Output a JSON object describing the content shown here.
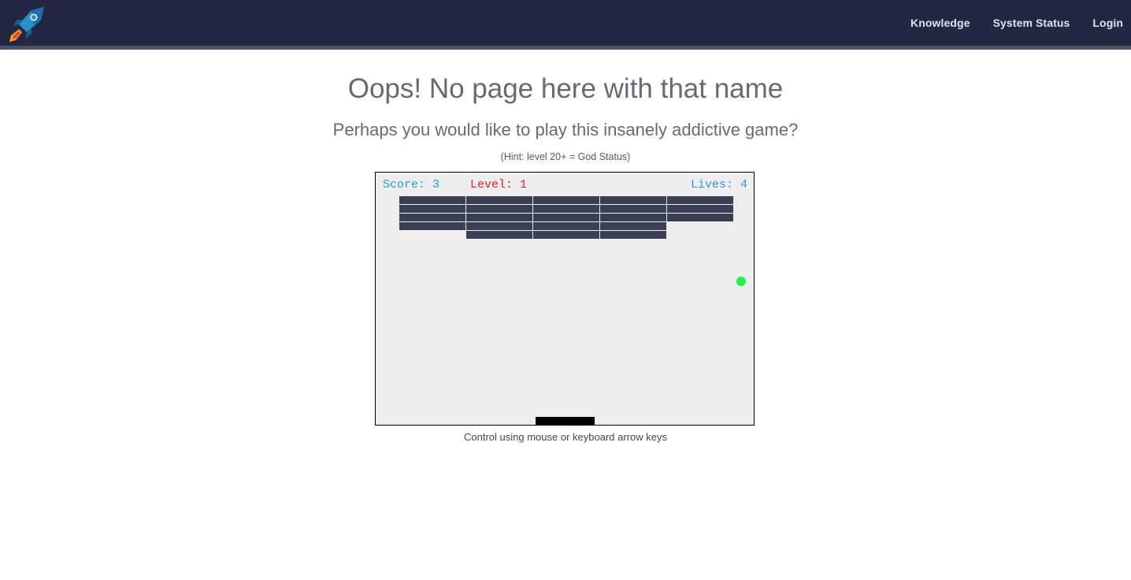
{
  "navbar": {
    "logo": "rocket-logo",
    "links": [
      "Knowledge",
      "System Status",
      "Login"
    ]
  },
  "main": {
    "title": "Oops! No page here with that name",
    "subtitle": "Perhaps you would like to play this insanely addictive game?",
    "hint": "(Hint: level 20+ = God Status)",
    "controls": "Control using mouse or keyboard arrow keys"
  },
  "game": {
    "score_label": "Score: 3",
    "level_label": "Level: 1",
    "lives_label": "Lives: 4",
    "colors": {
      "background": "#eeeeee",
      "brick": "#3b3f55",
      "ball": "#1df547",
      "paddle": "#000000",
      "score": "#2a9bd8",
      "level": "#d22a2a"
    },
    "bricks": [
      [
        1,
        1,
        1,
        1,
        1
      ],
      [
        1,
        1,
        1,
        1,
        1
      ],
      [
        1,
        1,
        1,
        1,
        1
      ],
      [
        1,
        1,
        1,
        1,
        0
      ],
      [
        0,
        1,
        1,
        1,
        0
      ]
    ]
  }
}
